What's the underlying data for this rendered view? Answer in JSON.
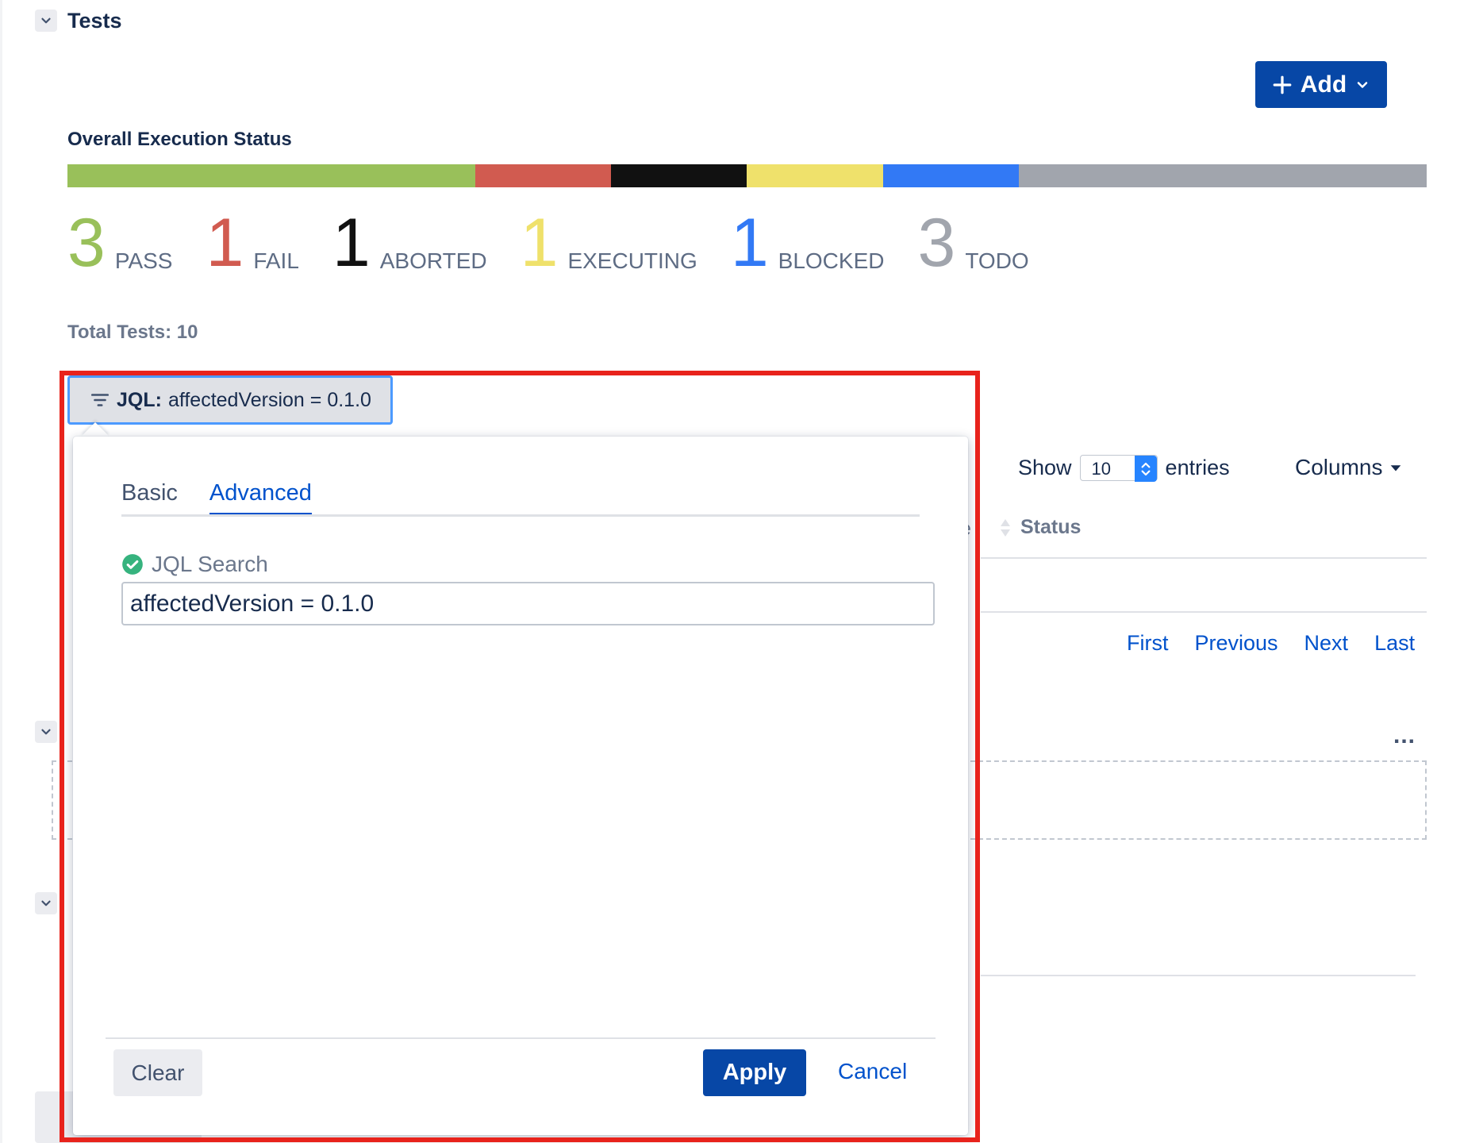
{
  "section": {
    "title": "Tests",
    "add_label": "Add"
  },
  "execution": {
    "label": "Overall Execution Status",
    "segments": [
      {
        "name": "PASS",
        "count": 3,
        "color": "#99c05a"
      },
      {
        "name": "FAIL",
        "count": 1,
        "color": "#d15b50"
      },
      {
        "name": "ABORTED",
        "count": 1,
        "color": "#111111"
      },
      {
        "name": "EXECUTING",
        "count": 1,
        "color": "#efe16b"
      },
      {
        "name": "BLOCKED",
        "count": 1,
        "color": "#3279f5"
      },
      {
        "name": "TODO",
        "count": 3,
        "color": "#a1a5ad"
      }
    ],
    "counts": {
      "pass_num": "3",
      "pass_lbl": "PASS",
      "fail_num": "1",
      "fail_lbl": "FAIL",
      "aborted_num": "1",
      "aborted_lbl": "ABORTED",
      "executing_num": "1",
      "executing_lbl": "EXECUTING",
      "blocked_num": "1",
      "blocked_lbl": "BLOCKED",
      "todo_num": "3",
      "todo_lbl": "TODO"
    },
    "total_label": "Total Tests: 10"
  },
  "table": {
    "show_label": "Show",
    "entries_value": "10",
    "entries_label": "entries",
    "columns_label": "Columns",
    "status_header": "Status",
    "pager": {
      "first": "First",
      "previous": "Previous",
      "next": "Next",
      "last": "Last"
    },
    "more_label": "..."
  },
  "filter": {
    "chip_prefix": "JQL:",
    "chip_value": "affectedVersion = 0.1.0"
  },
  "popup": {
    "tabs": [
      {
        "label": "Basic",
        "active": false
      },
      {
        "label": "Advanced",
        "active": true
      }
    ],
    "jql_label": "JQL Search",
    "jql_value": "affectedVersion = 0.1.0",
    "clear_label": "Clear",
    "apply_label": "Apply",
    "cancel_label": "Cancel"
  }
}
